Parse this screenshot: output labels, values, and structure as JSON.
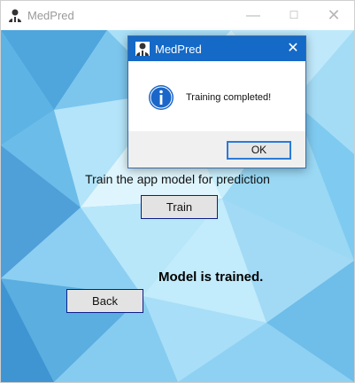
{
  "window": {
    "title": "MedPred",
    "icon": "user-avatar-icon",
    "controls": [
      "minimize-icon",
      "maximize-icon",
      "close-icon"
    ]
  },
  "main": {
    "train_label": "Train the app model for prediction",
    "train_button": "Train",
    "status_text": "Model is trained.",
    "back_button": "Back"
  },
  "dialog": {
    "title": "MedPred",
    "message": "Training completed!",
    "ok_button": "OK",
    "icon": "info-icon"
  },
  "colors": {
    "dialog_titlebar": "#1569c7",
    "info_icon": "#1a67c9",
    "button_border": "#0b1f8a",
    "background_light": "#bfe9fb",
    "background_dark": "#3f9ad6"
  }
}
